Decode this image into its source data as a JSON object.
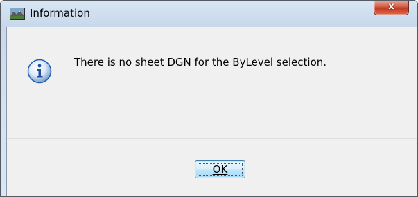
{
  "dialog": {
    "title": "Information",
    "message": "There is no sheet DGN for the ByLevel selection.",
    "ok_label": "OK",
    "close_glyph": "x",
    "app_icon": "landscape-app-icon",
    "message_icon": "information-icon"
  },
  "colors": {
    "close_button": "#c74328",
    "ok_button_border": "#3c7fb1",
    "info_icon_fill": "#1f6bc7"
  }
}
